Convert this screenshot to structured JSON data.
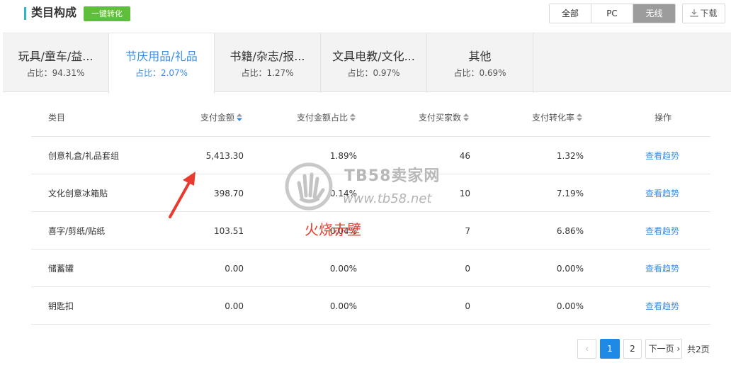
{
  "header": {
    "title": "类目构成",
    "convert_label": "一键转化",
    "segments": [
      "全部",
      "PC",
      "无线"
    ],
    "download_label": "下载"
  },
  "tabs": [
    {
      "name": "玩具/童车/益...",
      "share": "占比：94.31%"
    },
    {
      "name": "节庆用品/礼品",
      "share": "占比：2.07%"
    },
    {
      "name": "书籍/杂志/报...",
      "share": "占比：1.27%"
    },
    {
      "name": "文具电教/文化...",
      "share": "占比：0.97%"
    },
    {
      "name": "其他",
      "share": "占比：0.69%"
    }
  ],
  "table": {
    "columns": [
      "类目",
      "支付金额",
      "支付金额占比",
      "支付买家数",
      "支付转化率",
      "操作"
    ],
    "rows": [
      {
        "name": "创意礼盒/礼品套组",
        "amount": "5,413.30",
        "share": "1.89%",
        "buyers": "46",
        "conv": "1.32%",
        "op": "查看趋势"
      },
      {
        "name": "文化创意冰箱贴",
        "amount": "398.70",
        "share": "0.14%",
        "buyers": "10",
        "conv": "7.19%",
        "op": "查看趋势"
      },
      {
        "name": "喜字/剪纸/贴纸",
        "amount": "103.51",
        "share": "0.04%",
        "buyers": "7",
        "conv": "6.86%",
        "op": "查看趋势"
      },
      {
        "name": "储蓄罐",
        "amount": "0.00",
        "share": "0.00%",
        "buyers": "0",
        "conv": "0.00%",
        "op": "查看趋势"
      },
      {
        "name": "钥匙扣",
        "amount": "0.00",
        "share": "0.00%",
        "buyers": "0",
        "conv": "0.00%",
        "op": "查看趋势"
      }
    ]
  },
  "pager": {
    "pages": [
      "1",
      "2"
    ],
    "next_label": "下一页",
    "total_label": "共2页"
  },
  "watermark": {
    "site": "TB58卖家网",
    "url": "www.tb58.net",
    "red_text": "火烧赤壁"
  },
  "colors": {
    "accent_blue": "#3a8ee6",
    "convert_green": "#5fbf3d",
    "title_bar": "#2fb5c5",
    "arrow_red": "#e83a2e"
  }
}
